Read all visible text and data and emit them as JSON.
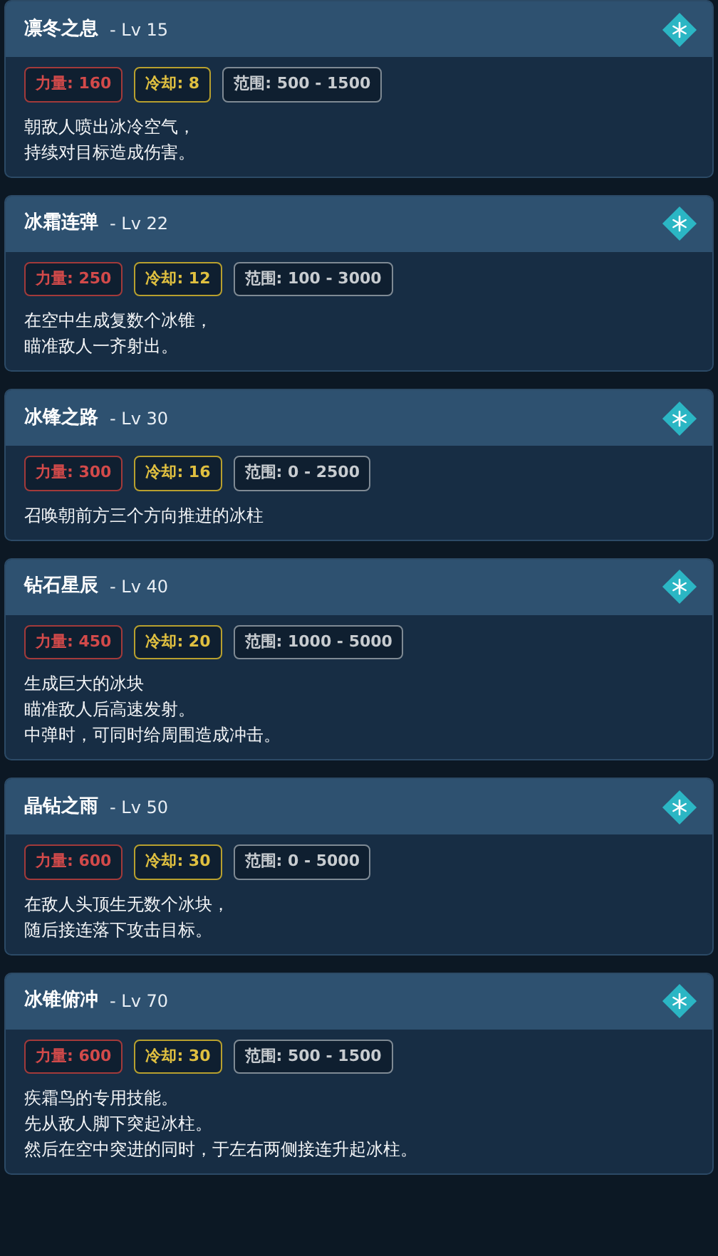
{
  "skills": [
    {
      "name": "凛冬之息",
      "level": "- Lv 15",
      "stats": [
        {
          "kind": "power",
          "text": "力量: 160"
        },
        {
          "kind": "cooldown",
          "text": "冷却: 8"
        },
        {
          "kind": "range",
          "text": "范围: 500 - 1500"
        }
      ],
      "description": [
        "朝敌人喷出冰冷空气，",
        "持续对目标造成伤害。"
      ]
    },
    {
      "name": "冰霜连弹",
      "level": "- Lv 22",
      "stats": [
        {
          "kind": "power",
          "text": "力量: 250"
        },
        {
          "kind": "cooldown",
          "text": "冷却: 12"
        },
        {
          "kind": "range",
          "text": "范围: 100 - 3000"
        }
      ],
      "description": [
        "在空中生成复数个冰锥，",
        "瞄准敌人一齐射出。"
      ]
    },
    {
      "name": "冰锋之路",
      "level": "- Lv 30",
      "stats": [
        {
          "kind": "power",
          "text": "力量: 300"
        },
        {
          "kind": "cooldown",
          "text": "冷却: 16"
        },
        {
          "kind": "range",
          "text": "范围: 0 - 2500"
        }
      ],
      "description": [
        "召唤朝前方三个方向推进的冰柱"
      ]
    },
    {
      "name": "钻石星辰",
      "level": "- Lv 40",
      "stats": [
        {
          "kind": "power",
          "text": "力量: 450"
        },
        {
          "kind": "cooldown",
          "text": "冷却: 20"
        },
        {
          "kind": "range",
          "text": "范围: 1000 - 5000"
        }
      ],
      "description": [
        "生成巨大的冰块",
        "瞄准敌人后高速发射。",
        "中弹时，可同时给周围造成冲击。"
      ]
    },
    {
      "name": "晶钻之雨",
      "level": "- Lv 50",
      "stats": [
        {
          "kind": "power",
          "text": "力量: 600"
        },
        {
          "kind": "cooldown",
          "text": "冷却: 30"
        },
        {
          "kind": "range",
          "text": "范围: 0 - 5000"
        }
      ],
      "description": [
        "在敌人头顶生无数个冰块，",
        "随后接连落下攻击目标。"
      ]
    },
    {
      "name": "冰锥俯冲",
      "level": "- Lv 70",
      "stats": [
        {
          "kind": "power",
          "text": "力量: 600"
        },
        {
          "kind": "cooldown",
          "text": "冷却: 30"
        },
        {
          "kind": "range",
          "text": "范围: 500 - 1500"
        }
      ],
      "description": [
        "疾霜鸟的专用技能。",
        "先从敌人脚下突起冰柱。",
        "然后在空中突进的同时，于左右两侧接连升起冰柱。"
      ]
    }
  ]
}
